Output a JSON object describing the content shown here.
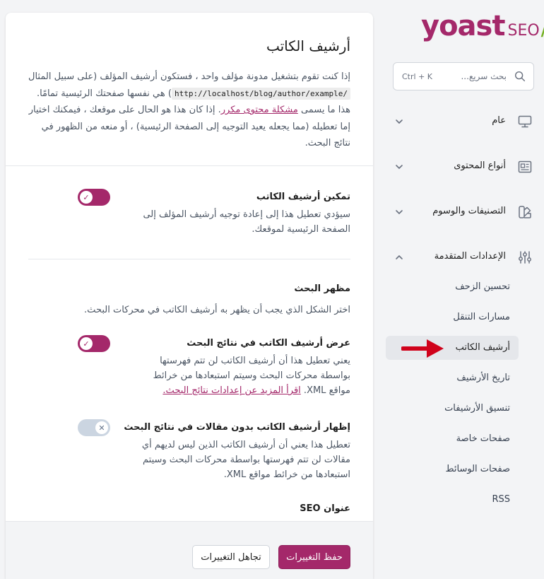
{
  "main": {
    "title": "أرشيف الكاتب",
    "intro_part1": "إذا كنت تقوم بتشغيل مدونة مؤلف واحد ، فستكون أرشيف المؤلف (على سبيل المثال ",
    "intro_code": "http://localhost/blog/author/example/",
    "intro_part2": ") هي نفسها صفحتك الرئيسية تمامًا. هذا ما يسمى ",
    "intro_link": "مشكلة محتوى مكرر",
    "intro_part3": ". إذا كان هذا هو الحال على موقعك ، فيمكنك اختيار إما تعطيله (مما يجعله يعيد التوجيه إلى الصفحة الرئيسية) ، أو منعه من الظهور في نتائج البحث.",
    "enable": {
      "label": "تمكين أرشيف الكاتب",
      "desc": "سيؤدي تعطيل هذا إلى إعادة توجيه أرشيف المؤلف إلى الصفحة الرئيسية لموقعك.",
      "state": "on"
    },
    "search_appearance": {
      "title": "مظهر البحث",
      "desc": "اختر الشكل الذي يجب أن يظهر به أرشيف الكاتب في محركات البحث."
    },
    "show_in_results": {
      "label": "عرض أرشيف الكاتب في نتائج البحث",
      "desc": "يعني تعطيل هذا أن أرشيف الكاتب لن تتم فهرستها بواسطة محركات البحث وسيتم استبعادها من خرائط مواقع XML. ",
      "link": "اقرأ المزيد عن إعدادات نتائج البحث.",
      "state": "on"
    },
    "show_without_posts": {
      "label": "إظهار أرشيف الكاتب بدون مقالات في نتائج البحث",
      "desc": "تعطيل هذا يعني أن أرشيف الكاتب الذين ليس لديهم أي مقالات لن تتم فهرستها بواسطة محركات البحث وسيتم استبعادها من خرائط مواقع XML.",
      "state": "off"
    },
    "seo_title_label": "عنوان SEO",
    "footer": {
      "save_label": "حفظ التغييرات",
      "discard_label": "تجاهل التغييرات"
    }
  },
  "sidebar": {
    "logo": {
      "brand": "yoast",
      "product": "SEO",
      "slash": "/"
    },
    "search": {
      "placeholder": "بحث سريع...",
      "shortcut": "Ctrl + K"
    },
    "groups": [
      {
        "label": "عام",
        "icon": "desktop-icon",
        "expanded": false
      },
      {
        "label": "أنواع المحتوى",
        "icon": "newspaper-icon",
        "expanded": false
      },
      {
        "label": "التصنيفات والوسوم",
        "icon": "swatch-icon",
        "expanded": false
      },
      {
        "label": "الإعدادات المتقدمة",
        "icon": "sliders-icon",
        "expanded": true
      }
    ],
    "advanced_items": [
      {
        "label": "تحسين الزحف",
        "active": false
      },
      {
        "label": "مسارات التنقل",
        "active": false
      },
      {
        "label": "أرشيف الكاتب",
        "active": true
      },
      {
        "label": "تاريخ الأرشيف",
        "active": false
      },
      {
        "label": "تنسيق الأرشيفات",
        "active": false
      },
      {
        "label": "صفحات خاصة",
        "active": false
      },
      {
        "label": "صفحات الوسائط",
        "active": false
      },
      {
        "label": "RSS",
        "active": false
      }
    ]
  },
  "colors": {
    "accent": "#a4286a",
    "arrow": "#d0021b",
    "logo_slash": "#77b227"
  }
}
